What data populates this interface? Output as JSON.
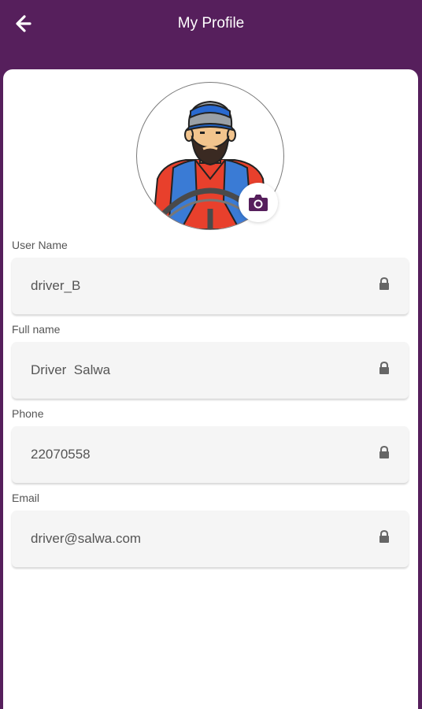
{
  "header": {
    "title": "My Profile",
    "back_icon": "arrow-left-icon"
  },
  "profile": {
    "avatar_icon": "driver-avatar-icon",
    "camera_icon": "camera-icon"
  },
  "fields": [
    {
      "label": "User Name",
      "value": "driver_B",
      "icon": "lock-icon"
    },
    {
      "label": "Full name",
      "value": "Driver  Salwa",
      "icon": "lock-icon"
    },
    {
      "label": "Phone",
      "value": "22070558",
      "icon": "lock-icon"
    },
    {
      "label": "Email",
      "value": "driver@salwa.com",
      "icon": "lock-icon"
    }
  ],
  "colors": {
    "header_bg": "#561f5c",
    "accent": "#561f5c",
    "field_bg": "#f5f5f5",
    "text": "#555555"
  }
}
